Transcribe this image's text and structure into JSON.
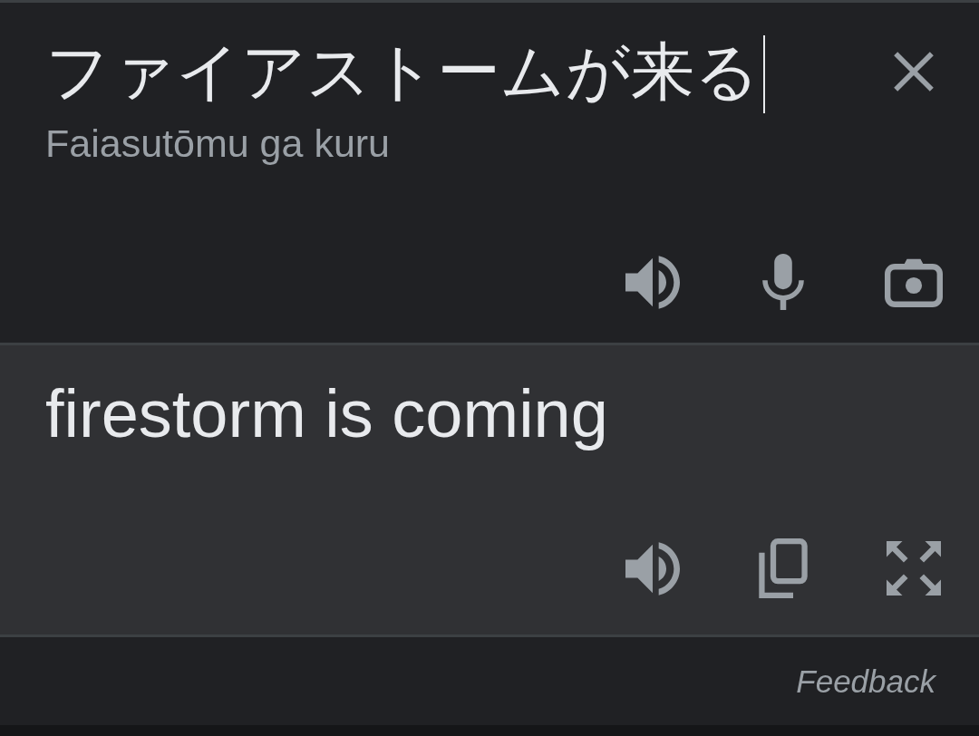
{
  "source": {
    "text": "ファイアストームが来る",
    "focused": true,
    "clear_button": true,
    "romanization": "Faiasutōmu ga kuru"
  },
  "source_actions": [
    {
      "kind": "listen"
    },
    {
      "kind": "voice"
    },
    {
      "kind": "camera"
    }
  ],
  "translation": {
    "text": "firestorm is coming"
  },
  "translation_actions": [
    {
      "kind": "listen"
    },
    {
      "kind": "copy"
    },
    {
      "kind": "fullscreen"
    }
  ],
  "footer": {
    "link": "Feedback"
  }
}
